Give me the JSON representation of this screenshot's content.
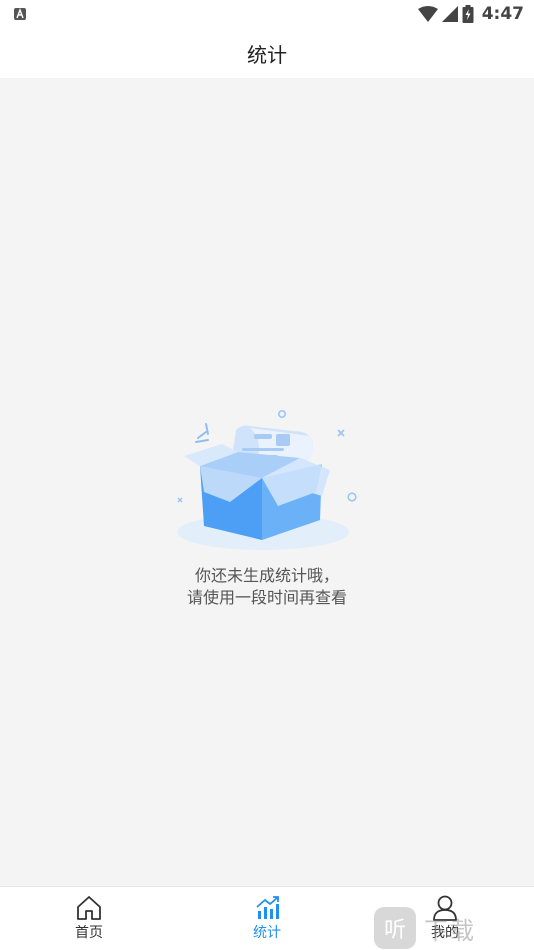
{
  "status_bar": {
    "time": "4:47",
    "icons": [
      "notification-a-icon",
      "wifi-icon",
      "signal-icon",
      "battery-charging-icon"
    ]
  },
  "header": {
    "title": "统计"
  },
  "empty_state": {
    "illustration": "empty-box-icon",
    "line1": "你还未生成统计哦，",
    "line2": "请使用一段时间再查看"
  },
  "bottom_nav": {
    "items": [
      {
        "label": "首页",
        "icon": "home-icon",
        "active": false
      },
      {
        "label": "统计",
        "icon": "chart-icon",
        "active": true
      },
      {
        "label": "我的",
        "icon": "user-icon",
        "active": false
      }
    ]
  },
  "colors": {
    "accent": "#1f8ff3",
    "background": "#f4f4f4",
    "box_blue": "#4c9ff5"
  },
  "watermark": {
    "badge": "听",
    "text": "下载"
  }
}
